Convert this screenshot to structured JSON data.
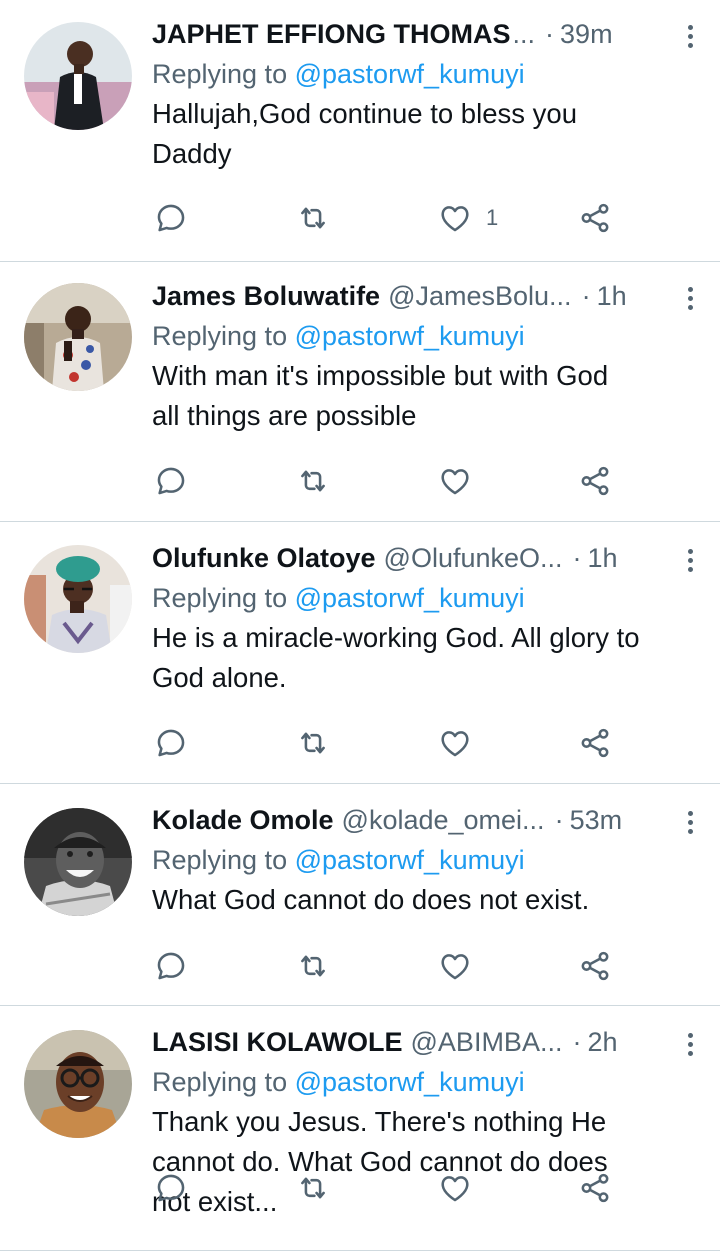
{
  "tweets": [
    {
      "name": "JAPHET EFFIONG THOMAS",
      "handle": "",
      "ellipsis": "...",
      "time": "39m",
      "reply_prefix": "Replying to",
      "reply_to": "@pastorwf_kumuyi",
      "text_lines": [
        "Hallujah,God continue to bless you",
        "Daddy"
      ],
      "like_count": "1"
    },
    {
      "name": "James Boluwatife",
      "handle": "@JamesBolu...",
      "ellipsis": "",
      "time": "1h",
      "reply_prefix": "Replying to",
      "reply_to": "@pastorwf_kumuyi",
      "text_lines": [
        "With man it's impossible but with God",
        "all things are possible"
      ],
      "like_count": ""
    },
    {
      "name": "Olufunke Olatoye",
      "handle": "@OlufunkeO...",
      "ellipsis": "",
      "time": "1h",
      "reply_prefix": "Replying to",
      "reply_to": "@pastorwf_kumuyi",
      "text_lines": [
        "He is a miracle-working God. All glory to",
        "God alone."
      ],
      "like_count": ""
    },
    {
      "name": "Kolade Omole",
      "handle": "@kolade_omei...",
      "ellipsis": "",
      "time": "53m",
      "reply_prefix": "Replying to",
      "reply_to": "@pastorwf_kumuyi",
      "text_lines": [
        "What God cannot do does not exist."
      ],
      "like_count": ""
    },
    {
      "name": "LASISI KOLAWOLE",
      "handle": "@ABIMBA...",
      "ellipsis": "",
      "time": "2h",
      "reply_prefix": "Replying to",
      "reply_to": "@pastorwf_kumuyi",
      "text_lines": [
        "Thank you Jesus. There's nothing He",
        "cannot do. What God cannot do does",
        "not exist..."
      ],
      "like_count": ""
    }
  ],
  "colors": {
    "link": "#1d9bf0",
    "secondary": "#536471",
    "divider": "#cfd9de",
    "text": "#0f1419"
  },
  "icons": {
    "reply": "comment-bubble-icon",
    "retweet": "retweet-arrows-icon",
    "like": "heart-icon",
    "share": "share-nodes-icon",
    "more": "vertical-dots-icon"
  },
  "separator": "·"
}
